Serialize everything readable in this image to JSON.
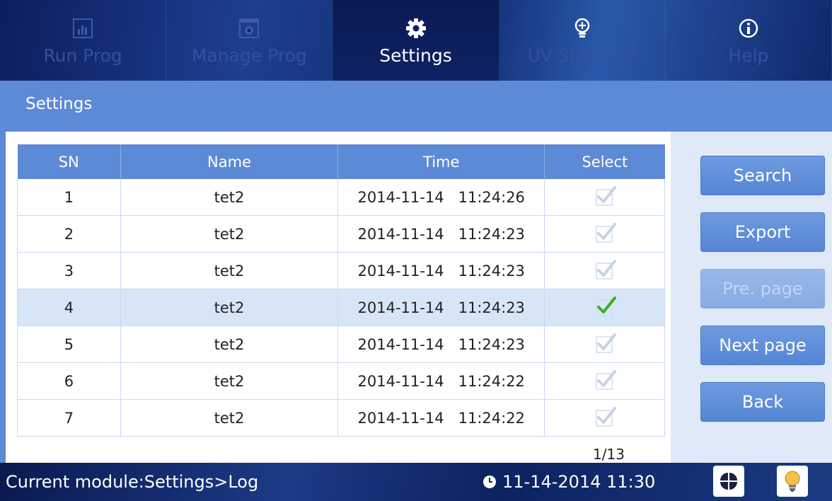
{
  "nav": {
    "tabs": [
      {
        "label": "Run Prog",
        "icon": "bar-chart-icon",
        "active": false
      },
      {
        "label": "Manage Prog",
        "icon": "gear-document-icon",
        "active": false
      },
      {
        "label": "Settings",
        "icon": "gear-icon",
        "active": true
      },
      {
        "label": "UV Sterilizer",
        "icon": "light-bulb-icon",
        "active": false
      },
      {
        "label": "Help",
        "icon": "info-icon",
        "active": false
      }
    ]
  },
  "titlebar": {
    "title": "Settings"
  },
  "table": {
    "headers": [
      "SN",
      "Name",
      "Time",
      "Select"
    ],
    "rows": [
      {
        "sn": "1",
        "name": "tet2",
        "time": "2014-11-14   11:24:26",
        "selected": false
      },
      {
        "sn": "2",
        "name": "tet2",
        "time": "2014-11-14   11:24:23",
        "selected": false
      },
      {
        "sn": "3",
        "name": "tet2",
        "time": "2014-11-14   11:24:23",
        "selected": false
      },
      {
        "sn": "4",
        "name": "tet2",
        "time": "2014-11-14   11:24:23",
        "selected": true
      },
      {
        "sn": "5",
        "name": "tet2",
        "time": "2014-11-14   11:24:23",
        "selected": false
      },
      {
        "sn": "6",
        "name": "tet2",
        "time": "2014-11-14   11:24:22",
        "selected": false
      },
      {
        "sn": "7",
        "name": "tet2",
        "time": "2014-11-14   11:24:22",
        "selected": false
      }
    ],
    "page_indicator": "1/13"
  },
  "buttons": {
    "search": "Search",
    "export": "Export",
    "prev_page": "Pre. page",
    "next_page": "Next page",
    "back": "Back"
  },
  "status": {
    "module": "Current module:Settings>Log",
    "datetime": "11-14-2014 11:30",
    "clock_icon": "clock-icon",
    "grid_icon": "fan-grid-icon",
    "bulb_icon": "light-bulb-icon"
  },
  "colors": {
    "accent": "#5d8ad6",
    "nav_dark": "#0c1e5e",
    "check_active": "#3fae2a",
    "check_inactive": "#c7d3e2"
  }
}
